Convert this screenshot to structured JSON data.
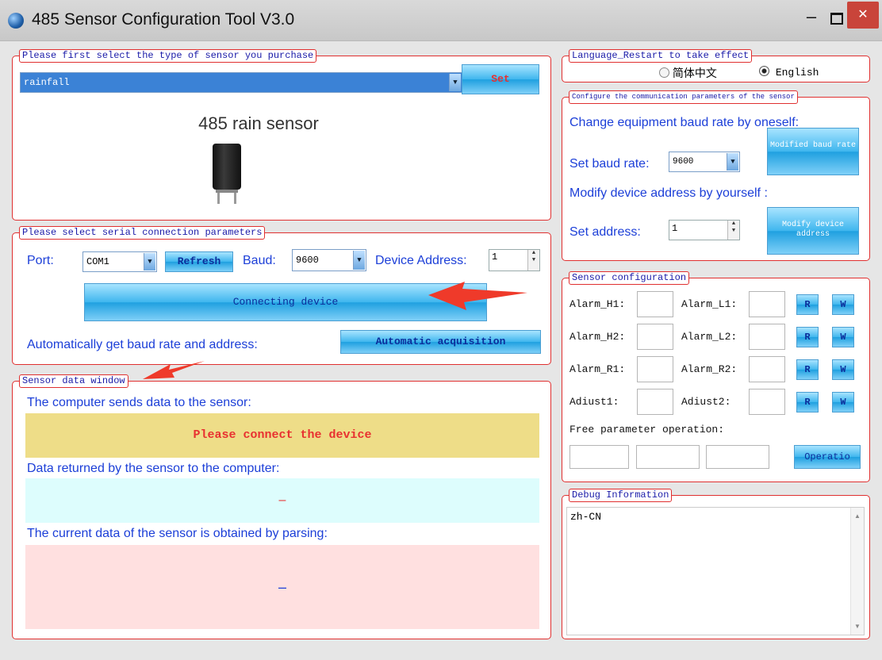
{
  "window": {
    "title": "485 Sensor Configuration Tool V3.0",
    "minimize_glyph": "–",
    "close_glyph": "✕"
  },
  "sensor_type": {
    "legend": "Please first select the type of sensor you purchase",
    "selected": "rainfall",
    "set_label": "Set",
    "sensor_name": "485 rain sensor"
  },
  "serial": {
    "legend": "Please select serial connection parameters",
    "port_label": "Port:",
    "port_value": "COM1",
    "refresh_label": "Refresh",
    "baud_label": "Baud:",
    "baud_value": "9600",
    "address_label": "Device Address:",
    "address_value": "1",
    "connect_label": "Connecting device",
    "auto_label": "Automatically get baud rate and address:",
    "auto_button": "Automatic acquisition"
  },
  "data_window": {
    "legend": "Sensor data window",
    "sends_label": "The computer sends data to the sensor:",
    "sends_value": "Please connect the device",
    "returned_label": "Data returned by the sensor to the computer:",
    "returned_value": "–",
    "parsed_label": "The current data of the sensor is obtained by parsing:",
    "parsed_value": "–"
  },
  "language": {
    "legend": "Language_Restart to take effect",
    "option_cn": "简体中文",
    "option_en": "English",
    "selected": "English"
  },
  "comm": {
    "legend": "Configure the communication parameters of the sensor",
    "baud_heading": "Change equipment baud rate by oneself:",
    "set_baud_label": "Set baud rate:",
    "baud_value": "9600",
    "modify_baud_button": "Modified baud rate",
    "address_heading": "Modify device address by yourself :",
    "set_address_label": "Set address:",
    "address_value": "1",
    "modify_address_button": "Modify device address"
  },
  "config": {
    "legend": "Sensor configuration",
    "rows": [
      {
        "left": "Alarm_H1:",
        "right": "Alarm_L1:"
      },
      {
        "left": "Alarm_H2:",
        "right": "Alarm_L2:"
      },
      {
        "left": "Alarm_R1:",
        "right": "Alarm_R2:"
      },
      {
        "left": "Adiust1:",
        "right": "Adiust2:"
      }
    ],
    "read_label": "R",
    "write_label": "W",
    "free_label": "Free parameter operation:",
    "operation_button": "Operatio"
  },
  "debug": {
    "legend": "Debug Information",
    "text": "zh-CN"
  },
  "colors": {
    "accent_red": "#e03030",
    "label_blue": "#1c3fd8",
    "sends_bg": "#eedd88",
    "returned_bg": "#ddfdfd",
    "parsed_bg": "#ffe0e0"
  }
}
